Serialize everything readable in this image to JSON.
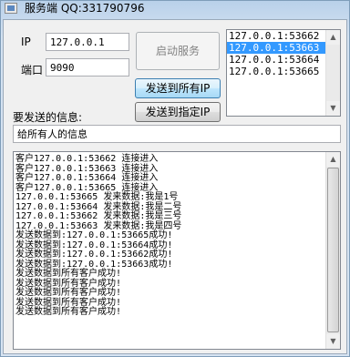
{
  "window": {
    "title": "服务端  QQ:331790796"
  },
  "form": {
    "ip_label": "IP",
    "ip_value": "127.0.0.1",
    "port_label": "端口",
    "port_value": "9090",
    "start_button": "启动服务",
    "send_all_button": "发送到所有IP",
    "send_selected_button": "发送到指定IP",
    "message_label": "要发送的信息:",
    "message_value": "给所有人的信息"
  },
  "clients": {
    "items": [
      "127.0.0.1:53662",
      "127.0.0.1:53663",
      "127.0.0.1:53664",
      "127.0.0.1:53665"
    ],
    "selected_index": 1
  },
  "log": {
    "lines": [
      "客户127.0.0.1:53662 连接进入",
      "客户127.0.0.1:53663 连接进入",
      "客户127.0.0.1:53664 连接进入",
      "客户127.0.0.1:53665 连接进入",
      "127.0.0.1:53665 发来数据:我是1号",
      "127.0.0.1:53664 发来数据:我是二号",
      "127.0.0.1:53662 发来数据:我是三号",
      "127.0.0.1:53663 发来数据:我是四号",
      "发送数据到:127.0.0.1:53665成功!",
      "发送数据到:127.0.0.1:53664成功!",
      "发送数据到:127.0.0.1:53662成功!",
      "发送数据到:127.0.0.1:53663成功!",
      "发送数据到所有客户成功!",
      "发送数据到所有客户成功!",
      "发送数据到所有客户成功!",
      "发送数据到所有客户成功!",
      "发送数据到所有客户成功!"
    ]
  }
}
